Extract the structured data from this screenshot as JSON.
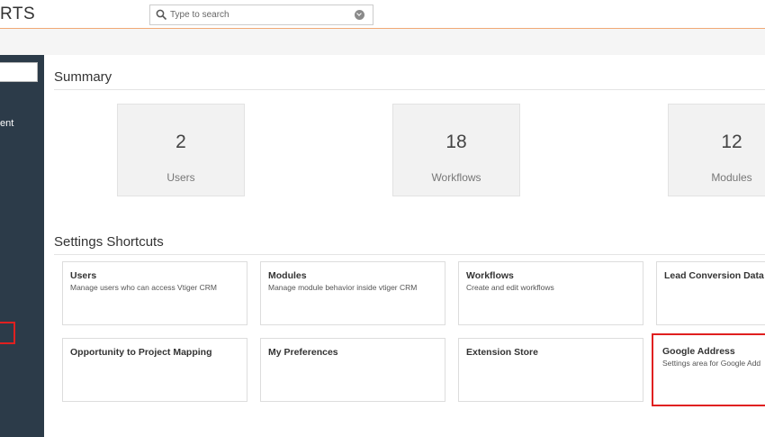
{
  "brand": "RTS",
  "search": {
    "placeholder": "Type to search"
  },
  "sidebar": {
    "partial_text": "ent"
  },
  "summary": {
    "title": "Summary",
    "stats": [
      {
        "value": "2",
        "label": "Users"
      },
      {
        "value": "18",
        "label": "Workflows"
      },
      {
        "value": "12",
        "label": "Modules"
      }
    ]
  },
  "shortcuts": {
    "title": "Settings Shortcuts",
    "cards": [
      {
        "title": "Users",
        "desc": "Manage users who can access Vtiger CRM"
      },
      {
        "title": "Modules",
        "desc": "Manage module behavior inside vtiger CRM"
      },
      {
        "title": "Workflows",
        "desc": "Create and edit workflows"
      },
      {
        "title": "Lead Conversion Data Ma",
        "desc": ""
      },
      {
        "title": "Opportunity to Project Mapping",
        "desc": ""
      },
      {
        "title": "My Preferences",
        "desc": ""
      },
      {
        "title": "Extension Store",
        "desc": ""
      },
      {
        "title": "Google Address",
        "desc": "Settings area for Google Add"
      }
    ]
  },
  "colors": {
    "sidebar": "#2c3b49",
    "accent_line": "#f0a875",
    "highlight": "#e02020"
  }
}
